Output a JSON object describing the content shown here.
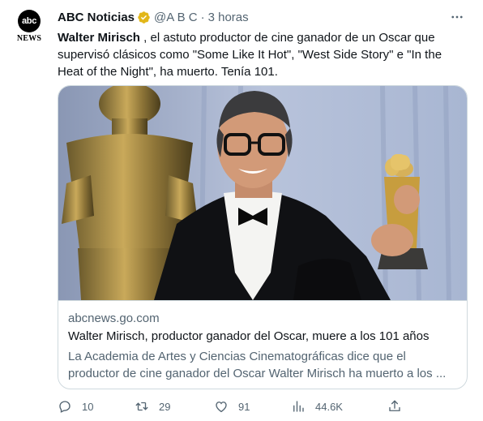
{
  "account": {
    "avatar_text": "abc",
    "avatar_subtext": "NEWS",
    "display_name": "ABC Noticias",
    "verified_icon": "verified-badge-gold",
    "handle": "@A B C",
    "separator": "·",
    "time": "3 horas"
  },
  "tweet": {
    "name_bold": "Walter Mirisch",
    "body": " , el astuto productor de cine ganador de un Oscar que supervisó clásicos como \"Some Like It Hot\", \"West Side Story\" e \"In the Heat of the Night\", ha muerto. Tenía 101."
  },
  "card": {
    "image_subject": "Walter Mirisch holding an Oscar statuette",
    "domain": "abcnews.go.com",
    "title": "Walter Mirisch, productor ganador del Oscar, muere a los 101 años",
    "description": "La Academia de Artes y Ciencias Cinematográficas dice que el productor de cine ganador del Oscar Walter Mirisch ha muerto a los ..."
  },
  "actions": {
    "reply_count": "10",
    "retweet_count": "29",
    "like_count": "91",
    "view_count": "44.6K"
  },
  "colors": {
    "text": "#0f1419",
    "secondary": "#536471",
    "border": "#cfd9de",
    "verified": "#e2b719"
  }
}
